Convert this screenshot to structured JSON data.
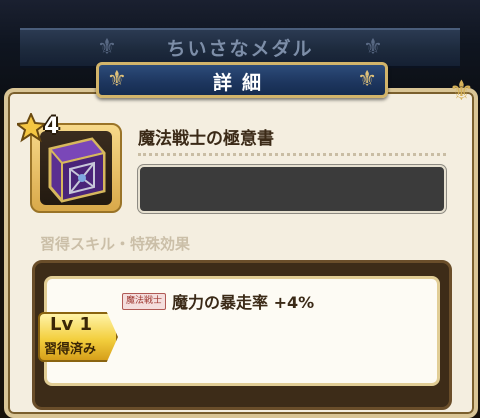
{
  "header": {
    "back_title": "ちいさなメダル",
    "detail_title": "詳細"
  },
  "item": {
    "star_count": "4",
    "name": "魔法戦士の極意書",
    "description": "",
    "icon": "purple-book-icon"
  },
  "section": {
    "label": "習得スキル・特殊効果"
  },
  "skill": {
    "class_tag": "魔法戦士",
    "text": "魔力の暴走率 +4%",
    "level_label": "Lv 1",
    "status": "習得済み"
  },
  "colors": {
    "panel": "#f4eee0",
    "banner": "#1e3760",
    "gold": "#d2b46a"
  }
}
